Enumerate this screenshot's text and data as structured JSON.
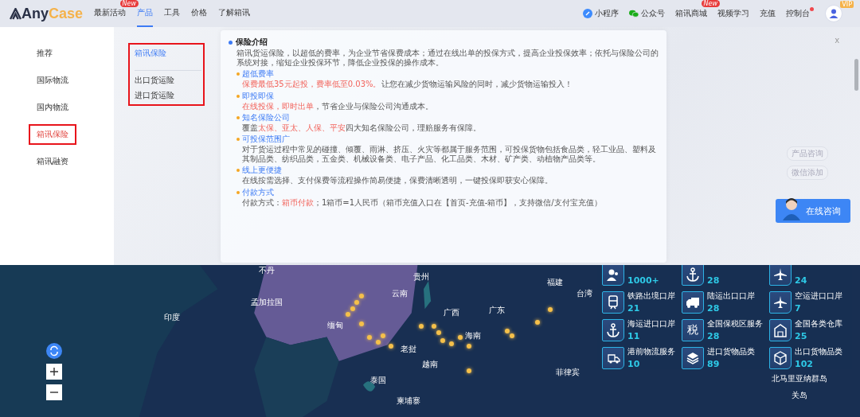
{
  "header": {
    "logo": {
      "prefix": "Any",
      "suffix": "Case"
    },
    "nav": [
      {
        "label": "最新活动",
        "selected": false,
        "badge": "New"
      },
      {
        "label": "产品",
        "selected": true
      },
      {
        "label": "工具",
        "selected": false
      },
      {
        "label": "价格",
        "selected": false
      },
      {
        "label": "了解箱讯",
        "selected": false
      }
    ],
    "right": [
      {
        "label": "小程序",
        "kind": "link-icon"
      },
      {
        "label": "公众号",
        "kind": "chat-icon"
      },
      {
        "label": "箱讯商城",
        "kind": "plain",
        "badge": "New"
      },
      {
        "label": "视频学习",
        "kind": "plain"
      },
      {
        "label": "充值",
        "kind": "plain"
      },
      {
        "label": "控制台",
        "kind": "plain",
        "dot": true
      }
    ],
    "avatar": {
      "badge": "VIP"
    }
  },
  "sidebar": {
    "items": [
      {
        "label": "推荐",
        "selected": false,
        "annotated": false
      },
      {
        "label": "国际物流",
        "selected": false,
        "annotated": false
      },
      {
        "label": "国内物流",
        "selected": false,
        "annotated": false
      },
      {
        "label": "箱讯保险",
        "selected": true,
        "annotated": true
      },
      {
        "label": "箱讯融资",
        "selected": false,
        "annotated": false
      }
    ]
  },
  "submenu": {
    "annotated": true,
    "title": "箱讯保险",
    "items": [
      "出口货运险",
      "进口货运险"
    ]
  },
  "close": "x",
  "insurance": {
    "title": "保险介绍",
    "intro": "箱讯货运保险，以超低的费率，为企业节省保费成本；通过在线出单的投保方式，提高企业投保效率；依托与保险公司的系统对接，缩短企业投保环节，降低企业投保的操作成本。",
    "sections": [
      {
        "title": "超低费率",
        "body": [
          {
            "text": "保费最低35元起投，费率低至0.03%。",
            "highlight": true
          },
          {
            "text": "让您在减少货物运输风险的同时，减少货物运输投入！",
            "highlight": false
          }
        ]
      },
      {
        "title": "即投即保",
        "body": [
          {
            "text": "在线投保，即时出单",
            "highlight": true
          },
          {
            "text": "，节省企业与保险公司沟通成本。",
            "highlight": false
          }
        ]
      },
      {
        "title": "知名保险公司",
        "body": [
          {
            "text": "覆盖",
            "highlight": false
          },
          {
            "text": "太保、亚太、人保、平安",
            "highlight": true
          },
          {
            "text": "四大知名保险公司，理赔服务有保障。",
            "highlight": false
          }
        ]
      },
      {
        "title": "可投保范围广",
        "body": [
          {
            "text": "对于货运过程中常见的碰撞、倾覆、雨淋、挤压、火灾等都属于服务范围，可投保货物包括食品类，轻工业品、塑料及其制品类、纺织品类，五金类、机械设备类、电子产品、化工品类、木材、矿产类、动植物产品类等。",
            "highlight": false
          }
        ]
      },
      {
        "title": "线上更便捷",
        "body": [
          {
            "text": "在线按需选择、支付保费等流程操作简易便捷，保费清晰透明，一键投保即获安心保障。",
            "highlight": false
          }
        ]
      },
      {
        "title": "付款方式",
        "body": [
          {
            "text": "付款方式：",
            "highlight": false
          },
          {
            "text": "箱币付款",
            "highlight": true
          },
          {
            "text": "；1箱币=1人民币（箱币充值入口在【首页-充值-箱币】，支持微信/支付宝充值）",
            "highlight": false
          }
        ]
      }
    ]
  },
  "float_buttons": [
    "产品咨询",
    "微信添加"
  ],
  "online_consult": "在线咨询",
  "map": {
    "labels": [
      "不丹",
      "贵州",
      "云南",
      "福建",
      "台湾",
      "孟加拉国",
      "广西",
      "广东",
      "印度",
      "缅甸",
      "海南",
      "老挝",
      "越南",
      "泰国",
      "菲律宾",
      "柬埔寨",
      "北马里亚纳群岛",
      "关岛"
    ],
    "stats": [
      {
        "kind": "people",
        "value": "1000+"
      },
      {
        "kind": "anchor",
        "value": "28"
      },
      {
        "kind": "plane",
        "value": "24"
      },
      {
        "kind": "train",
        "label": "铁路出境口岸",
        "value": "21"
      },
      {
        "kind": "truck",
        "label": "陆运出口口岸",
        "value": "28"
      },
      {
        "kind": "plane",
        "label": "空运进口口岸",
        "value": "7"
      },
      {
        "kind": "anchor",
        "label": "海运进口口岸",
        "value": "11"
      },
      {
        "kind": "glyph",
        "glyph": "税",
        "label": "全国保税区服务",
        "value": "28"
      },
      {
        "kind": "warehouse",
        "label": "全国各类仓库",
        "value": "25"
      },
      {
        "kind": "delivery",
        "label": "港前物流服务",
        "value": "10"
      },
      {
        "kind": "layers",
        "label": "进口货物品类",
        "value": "89"
      },
      {
        "kind": "box",
        "label": "出口货物品类",
        "value": "102"
      }
    ]
  }
}
